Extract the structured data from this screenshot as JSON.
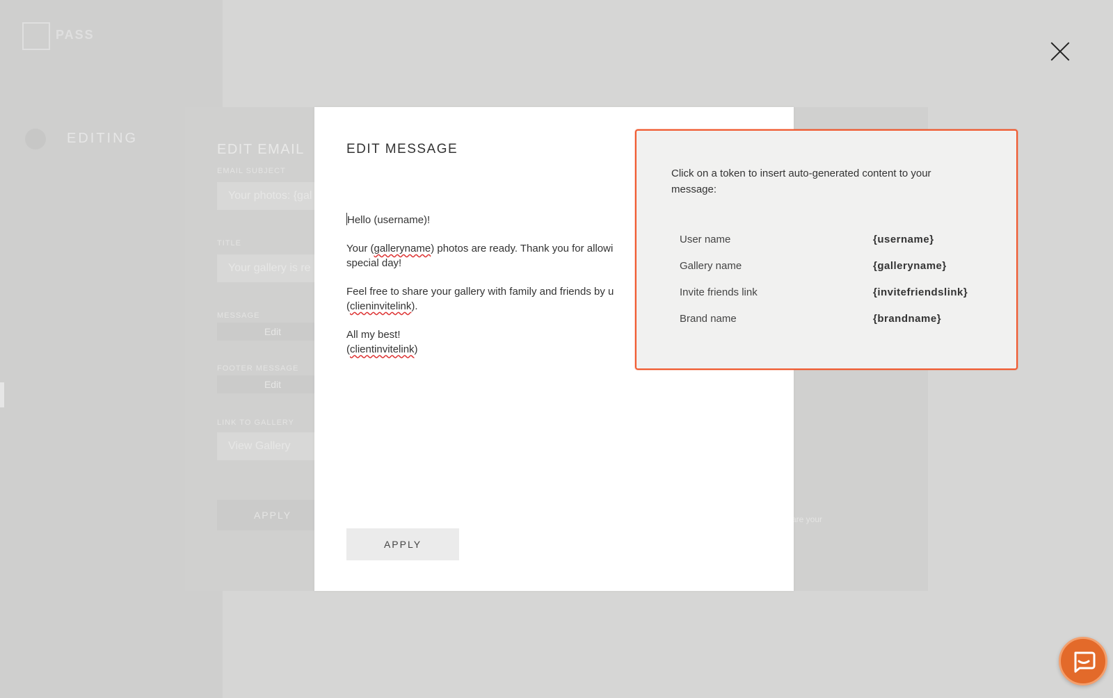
{
  "background": {
    "logo_text": "PASS",
    "sidebar_label": "EDITING"
  },
  "edit_email": {
    "title": "EDIT EMAIL",
    "subject_label": "EMAIL SUBJECT",
    "subject_value": "Your photos: {gal",
    "title_label": "TITLE",
    "title_value": "Your gallery is re",
    "message_label": "MESSAGE",
    "message_edit": "Edit",
    "footer_label": "FOOTER MESSAGE",
    "footer_edit": "Edit",
    "link_label": "LINK TO GALLERY",
    "link_value": "View Gallery",
    "apply": "APPLY",
    "hint": "are your"
  },
  "edit_message": {
    "title": "EDIT MESSAGE",
    "lines": {
      "greeting": "Hello (username)!",
      "p2_a": "Your (",
      "p2_token": "galleryname",
      "p2_b": ") photos are ready. Thank you for allowi",
      "p2_c": "special day!",
      "p3_a": "Feel free to share your gallery with family and friends by u",
      "p3_b": "(",
      "p3_token": "clieninvitelink",
      "p3_c": ").",
      "p4_a": "All my best!",
      "p4_b": "(",
      "p4_token": "clientinvitelink",
      "p4_c": ")"
    },
    "apply": "APPLY"
  },
  "token_panel": {
    "intro": "Click on a token to insert auto-generated content to your message:",
    "tokens": [
      {
        "name": "User name",
        "token": "{username}"
      },
      {
        "name": "Gallery name",
        "token": "{galleryname}"
      },
      {
        "name": "Invite friends link",
        "token": "{invitefriendslink}"
      },
      {
        "name": "Brand name",
        "token": "{brandname}"
      }
    ]
  },
  "colors": {
    "accent": "#f05a30",
    "chat": "#e36a2a"
  },
  "icons": {
    "close": "close-icon",
    "chat": "chat-icon"
  }
}
